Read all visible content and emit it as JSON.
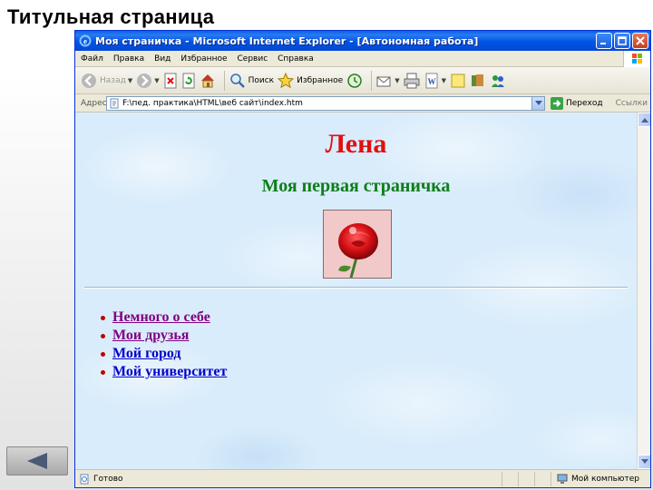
{
  "slide": {
    "title": "Титульная страница"
  },
  "nav": {
    "back_icon": "left-arrow-icon"
  },
  "browser": {
    "window_title": "Моя страничка - Microsoft Internet Explorer - [Автономная работа]",
    "menu": [
      "Файл",
      "Правка",
      "Вид",
      "Избранное",
      "Сервис",
      "Справка"
    ],
    "toolbar": {
      "back_label": "Назад",
      "search_label": "Поиск",
      "favorites_label": "Избранное"
    },
    "address": {
      "label": "Адрес:",
      "value": "F:\\пед. практика\\HTML\\веб сайт\\index.htm",
      "go_label": "Переход",
      "links_label": "Ссылки"
    },
    "status": {
      "left_text": "Готово",
      "zone_text": "Мой компьютер"
    }
  },
  "webpage": {
    "heading": "Лена",
    "subheading": "Моя первая страничка",
    "image_subject": "red rose",
    "links": [
      {
        "label": "Немного о себе",
        "state": "visited"
      },
      {
        "label": "Мои друзья",
        "state": "visited"
      },
      {
        "label": "Мой город",
        "state": "link"
      },
      {
        "label": "Мой университет",
        "state": "link"
      }
    ],
    "colors": {
      "heading": "#e01010",
      "subheading": "#0f7d1a",
      "visited_link": "#800080",
      "link": "#0000cc"
    }
  }
}
